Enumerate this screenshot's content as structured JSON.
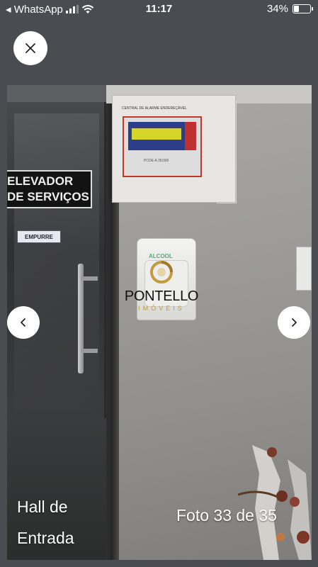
{
  "status_bar": {
    "back_app": "◂ WhatsApp",
    "time": "11:17",
    "battery_percent": "34%",
    "battery_level": 0.34,
    "icons": [
      "signal-bars-icon",
      "wifi-icon",
      "battery-icon"
    ]
  },
  "viewer": {
    "caption": "Hall de Entrada",
    "counter": "Foto 33 de 35",
    "close_icon": "close-icon",
    "prev_icon": "chevron-left-icon",
    "next_icon": "chevron-right-icon"
  },
  "photo": {
    "sign_line1": "ELEVADOR",
    "sign_line2": "DE SERVIÇOS",
    "small_sign": "EMPURRE",
    "panel_title": "CENTRAL DE ALARME ENDEREÇÁVEL",
    "panel_code": "PCDE-A 35/300",
    "dispenser_label": "ALCOOL",
    "watermark_name": "PONTELLO",
    "watermark_sub": "IMÓVEIS"
  },
  "colors": {
    "background": "#4b4c52",
    "watermark_gold": "#c49a3c",
    "button": "#ffffff"
  }
}
